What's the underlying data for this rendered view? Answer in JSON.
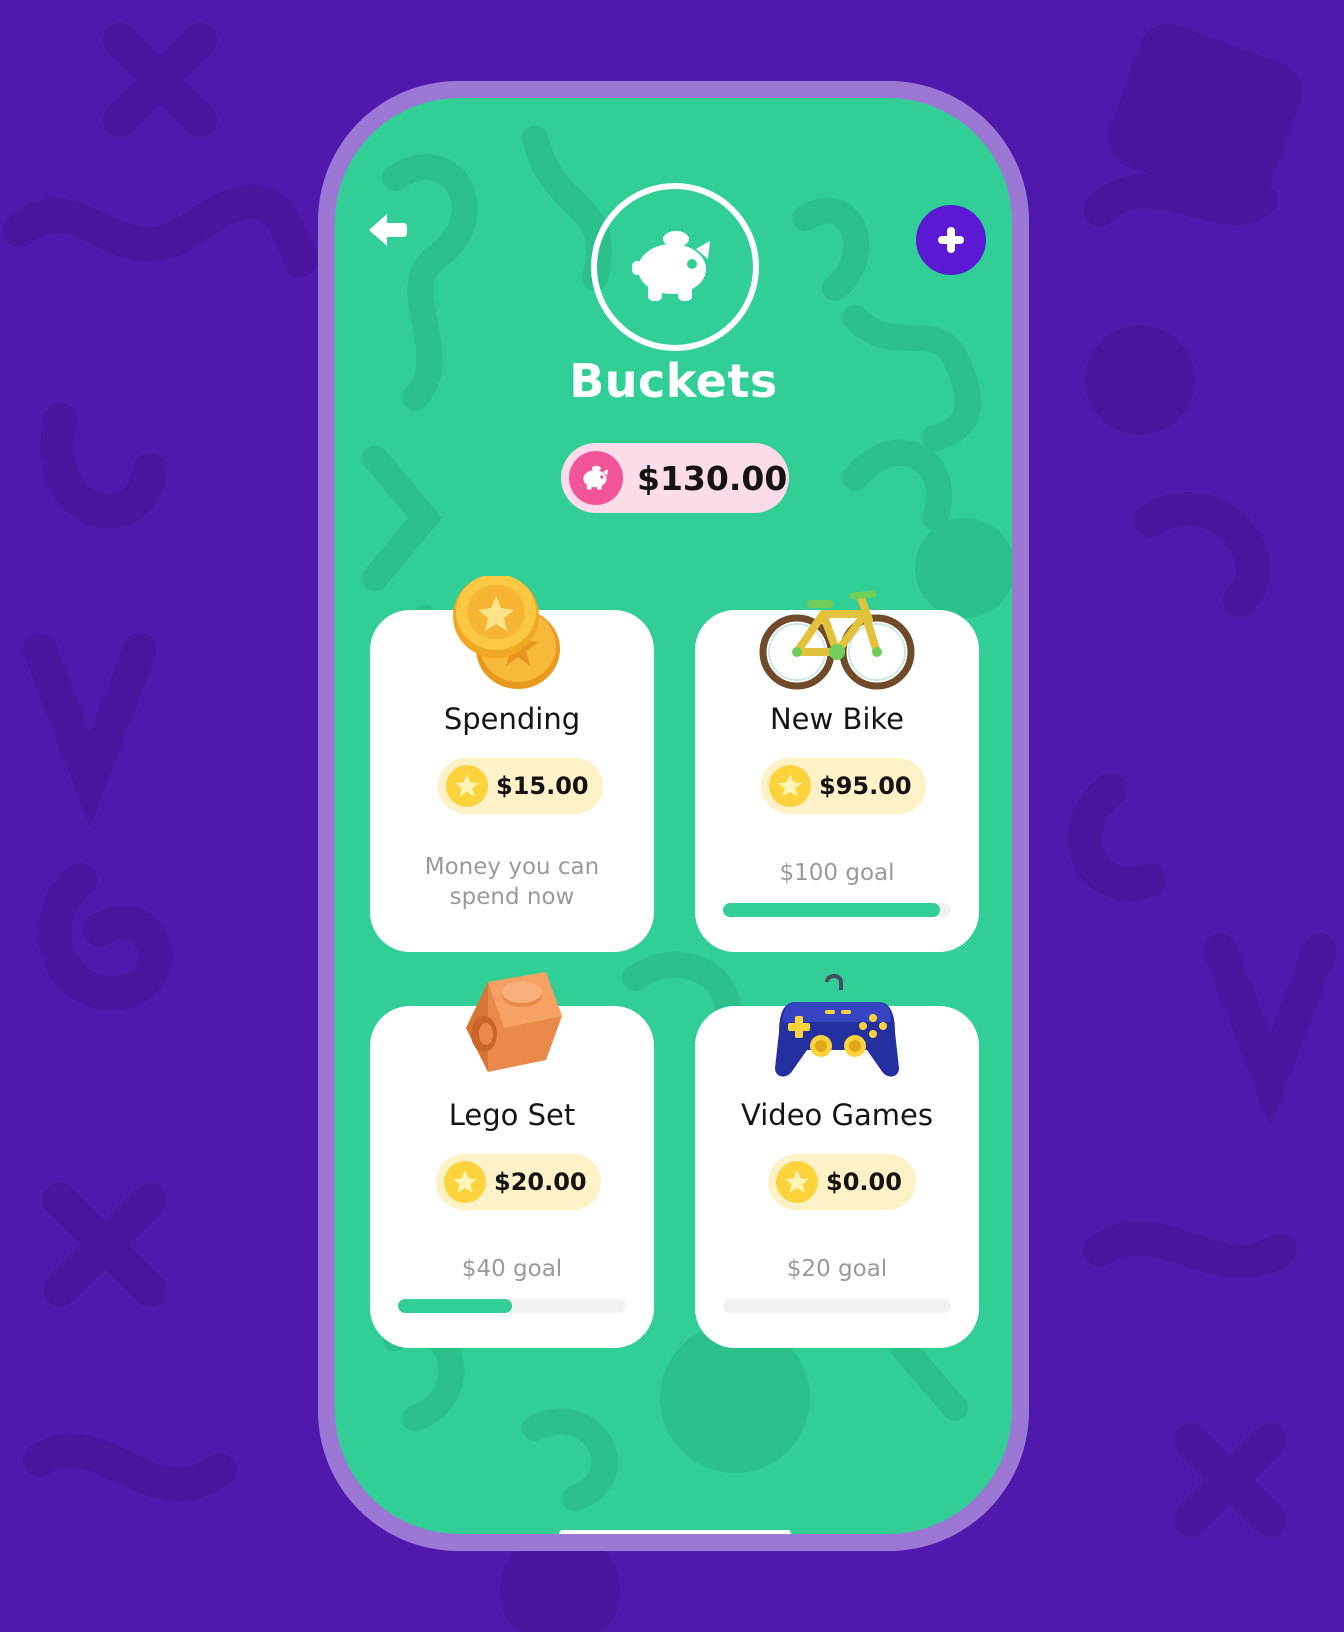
{
  "colors": {
    "background": "#5019ad",
    "screen": "#31ce96",
    "accent_purple": "#5a19d2",
    "pill_pink": "#fbdce8",
    "coin_yellow": "#fcd33c"
  },
  "header": {
    "back_icon": "back-arrow-icon",
    "add_icon": "plus-icon",
    "hero_icon": "piggy-bank-icon",
    "title": "Buckets",
    "total": "$130.00"
  },
  "buckets": [
    {
      "name": "Spending",
      "amount": "$15.00",
      "description": "Money you can spend now",
      "icon": "coins-icon"
    },
    {
      "name": "New Bike",
      "amount": "$95.00",
      "goal": "$100 goal",
      "progress": 0.95,
      "icon": "bicycle-icon"
    },
    {
      "name": "Lego Set",
      "amount": "$20.00",
      "goal": "$40 goal",
      "progress": 0.5,
      "icon": "lego-brick-icon"
    },
    {
      "name": "Video Games",
      "amount": "$0.00",
      "goal": "$20 goal",
      "progress": 0,
      "icon": "gamepad-icon"
    }
  ]
}
